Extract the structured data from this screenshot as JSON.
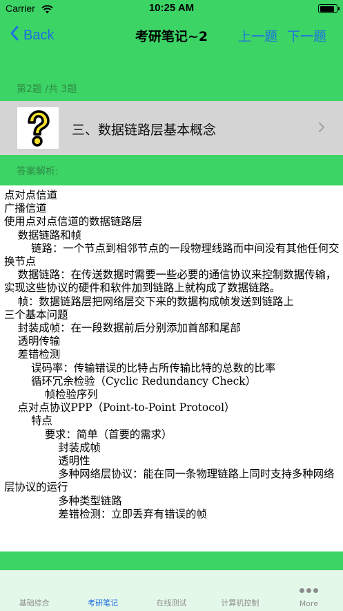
{
  "status_bar": {
    "carrier": "Carrier",
    "time": "10:25 AM",
    "battery_level": 0.9
  },
  "nav": {
    "back_label": "Back",
    "title": "考研笔记~2",
    "prev_label": "上一题",
    "next_label": "下一题"
  },
  "question": {
    "index_text": "第2题 /共 3题",
    "chapter_title": "三、数据链路层基本概念",
    "answer_label": "答案解析:"
  },
  "content": {
    "lines": [
      "点对点信道",
      "广播信道",
      "",
      "使用点对点信道的数据链路层",
      "    数据链路和帧",
      "        链路：一个节点到相邻节点的一段物理线路而中间没有其他任何交换节点",
      "    数据链路：在传送数据时需要一些必要的通信协议来控制数据传输，实现这些协议的硬件和软件加到链路上就构成了数据链路。",
      "    帧：数据链路层把网络层交下来的数据构成帧发送到链路上",
      "三个基本问题",
      "    封装成帧：在一段数据前后分别添加首部和尾部",
      "    透明传输",
      "    差错检测",
      "        误码率：传输错误的比特占所传输比特的总数的比率",
      "        循环冗余检验（Cyclic Redundancy Check）",
      "            帧检验序列",
      "    点对点协议PPP（Point-to-Point Protocol）",
      "        特点",
      "            要求：简单（首要的需求）",
      "                封装成帧",
      "                透明性",
      "                多种网络层协议：能在同一条物理链路上同时支持多种网络层协议的运行",
      "                多种类型链路",
      "                差错检测：立即丢弃有错误的帧"
    ]
  },
  "tabs": [
    {
      "label": "基础综合",
      "active": false
    },
    {
      "label": "考研笔记",
      "active": true
    },
    {
      "label": "在线测试",
      "active": false
    },
    {
      "label": "计算机控制",
      "active": false
    },
    {
      "label": "More",
      "active": false
    }
  ],
  "colors": {
    "green": "#3cd465",
    "accent_blue": "#1f6fe0",
    "chapter_row_gray": "#d4d4d4",
    "tab_bar_bg": "#e4f8ea"
  },
  "icons": {
    "wifi": "wifi-icon",
    "battery": "battery-icon",
    "back": "chevron-left-icon",
    "chapter": "question-mark-icon",
    "chapter_arrow": "chevron-right-icon",
    "more": "ellipsis-icon"
  }
}
